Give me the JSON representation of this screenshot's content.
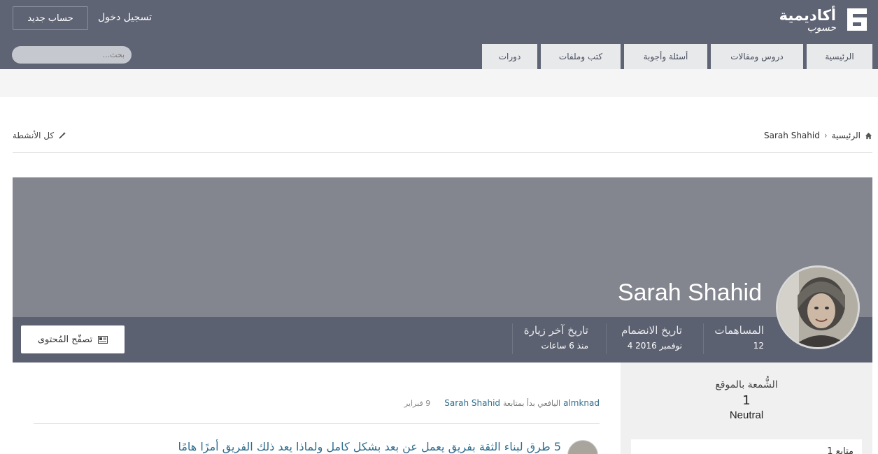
{
  "header": {
    "logo_text_main": "أكاديمية",
    "logo_text_sub": "حسوب",
    "register_label": "حساب جديد",
    "login_label": "تسجيل دخول",
    "nav_items": [
      {
        "label": "الرئيسية"
      },
      {
        "label": "دروس ومقالات"
      },
      {
        "label": "أسئلة وأجوبة"
      },
      {
        "label": "كتب وملفات"
      },
      {
        "label": "دورات"
      }
    ],
    "search": {
      "placeholder": "بحث...",
      "value": ""
    }
  },
  "breadcrumb": {
    "home_label": "الرئيسية",
    "current": "Sarah Shahid"
  },
  "activity_link_label": "كل الأنشطة",
  "profile": {
    "name": "Sarah Shahid",
    "stats": [
      {
        "label": "المساهمات",
        "value": "12"
      },
      {
        "label": "تاريخ الانضمام",
        "value": "4 نوفمبر 2016"
      },
      {
        "label": "تاريخ آخر زيارة",
        "value": "منذ 6 ساعات"
      }
    ],
    "browse_content_label": "تصفّح المُحتوى"
  },
  "sidebar": {
    "reputation_title": "الشُّمعة بالموقع",
    "reputation_value": "1",
    "reputation_label": "Neutral",
    "card_text": "1 متابع"
  },
  "feed": {
    "activity": {
      "actor": "almknad",
      "action": "اليافعي بدأ بمتابعة",
      "target": "Sarah Shahid",
      "date": "9 فبراير"
    },
    "article_title": "5 طرق لبناء الثقة بفريق يعمل عن بعد بشكل كامل ولماذا يعد ذلك الفريق أمرًا هامًا"
  },
  "colors": {
    "header_bg": "#5f6475",
    "cover_bg": "#83858f",
    "stats_bg": "#5c6171",
    "link": "#2f6e8f"
  }
}
